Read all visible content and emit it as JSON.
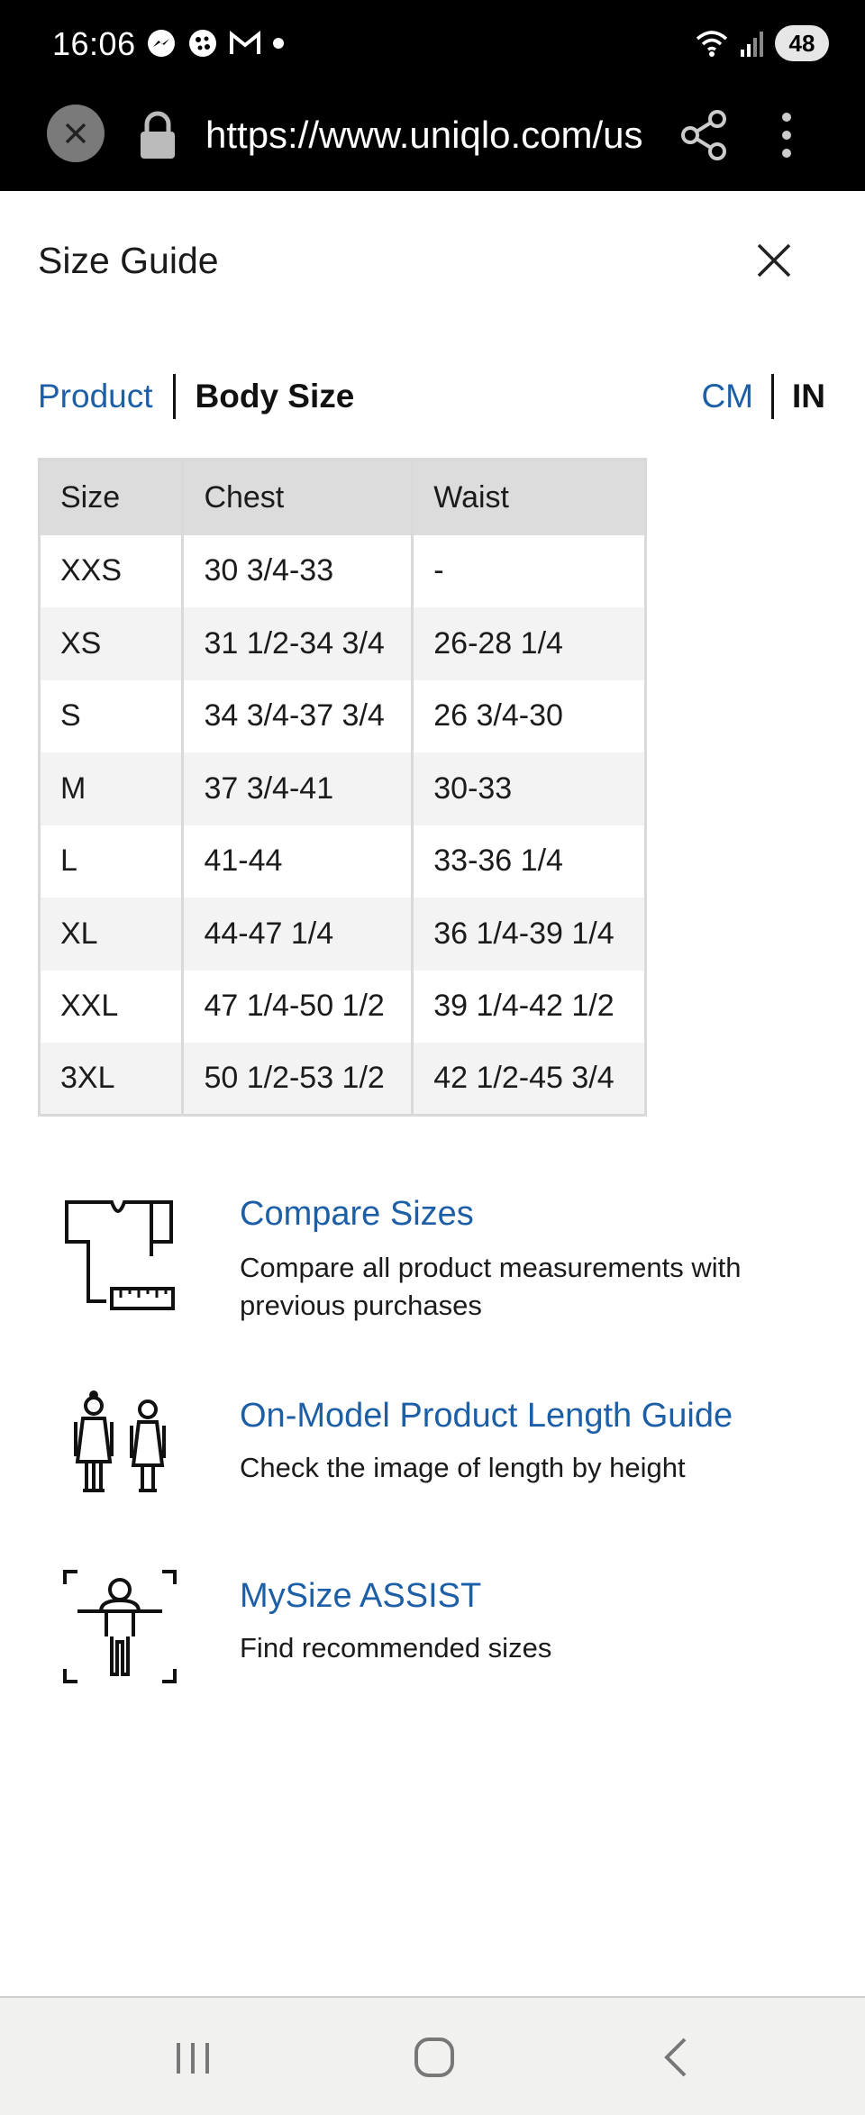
{
  "status_bar": {
    "time": "16:06",
    "battery": "48",
    "icons": [
      "messenger-icon",
      "cookie-icon",
      "gmail-icon",
      "dot-icon",
      "wifi-icon",
      "signal-icon",
      "battery-icon"
    ]
  },
  "browser": {
    "url": "https://www.uniqlo.com/us",
    "icons": [
      "close-icon",
      "lock-icon",
      "share-icon",
      "more-vert-icon"
    ]
  },
  "header": {
    "title": "Size Guide"
  },
  "tabs": {
    "product": "Product",
    "body_size": "Body Size",
    "active": "Body Size"
  },
  "units": {
    "cm": "CM",
    "in": "IN",
    "active": "IN"
  },
  "table": {
    "headers": [
      "Size",
      "Chest",
      "Waist"
    ],
    "rows": [
      [
        "XXS",
        "30 3/4-33",
        "-"
      ],
      [
        "XS",
        "31 1/2-34 3/4",
        "26-28 1/4"
      ],
      [
        "S",
        "34 3/4-37 3/4",
        "26 3/4-30"
      ],
      [
        "M",
        "37 3/4-41",
        "30-33"
      ],
      [
        "L",
        "41-44",
        "33-36 1/4"
      ],
      [
        "XL",
        "44-47 1/4",
        "36 1/4-39 1/4"
      ],
      [
        "XXL",
        "47 1/4-50 1/2",
        "39 1/4-42 1/2"
      ],
      [
        "3XL",
        "50 1/2-53 1/2",
        "42 1/2-45 3/4"
      ]
    ]
  },
  "features": [
    {
      "title": "Compare Sizes",
      "desc": "Compare all product measurements with previous purchases",
      "icon": "shirt-ruler-icon"
    },
    {
      "title": "On-Model Product Length Guide",
      "desc": "Check the image of length by height",
      "icon": "models-icon"
    },
    {
      "title": "MySize ASSIST",
      "desc": "Find recommended sizes",
      "icon": "body-scan-icon"
    }
  ],
  "colors": {
    "link": "#1d5fa6",
    "header_bg": "#dcdcdc",
    "stripe": "#f3f3f3"
  }
}
